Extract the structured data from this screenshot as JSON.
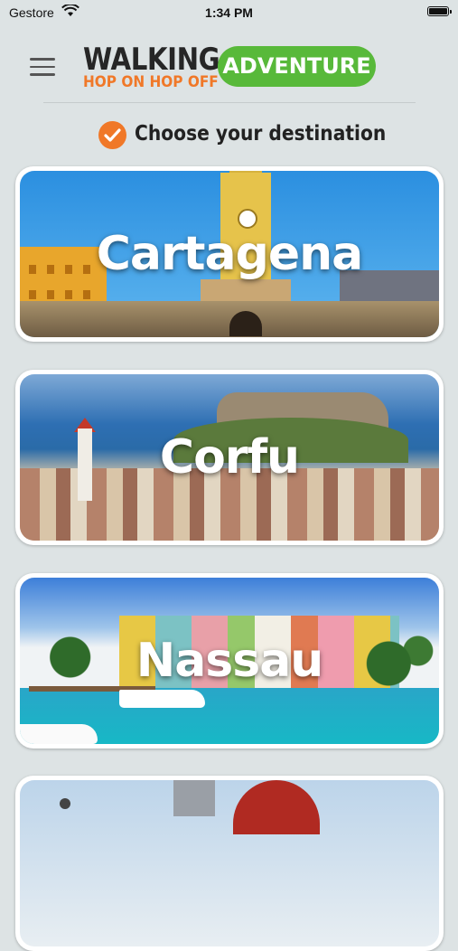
{
  "status_bar": {
    "carrier": "Gestore",
    "time": "1:34 PM"
  },
  "header": {
    "logo_line1": "WALKING",
    "logo_line2": "HOP ON HOP OFF",
    "logo_badge": "ADVENTURE"
  },
  "colors": {
    "accent_orange": "#f07828",
    "accent_green": "#58b93a",
    "background": "#dde3e4"
  },
  "prompt": {
    "icon": "check-circle-icon",
    "text": "Choose your destination"
  },
  "destinations": [
    {
      "label": "Cartagena"
    },
    {
      "label": "Corfu"
    },
    {
      "label": "Nassau"
    },
    {
      "label": ""
    }
  ]
}
